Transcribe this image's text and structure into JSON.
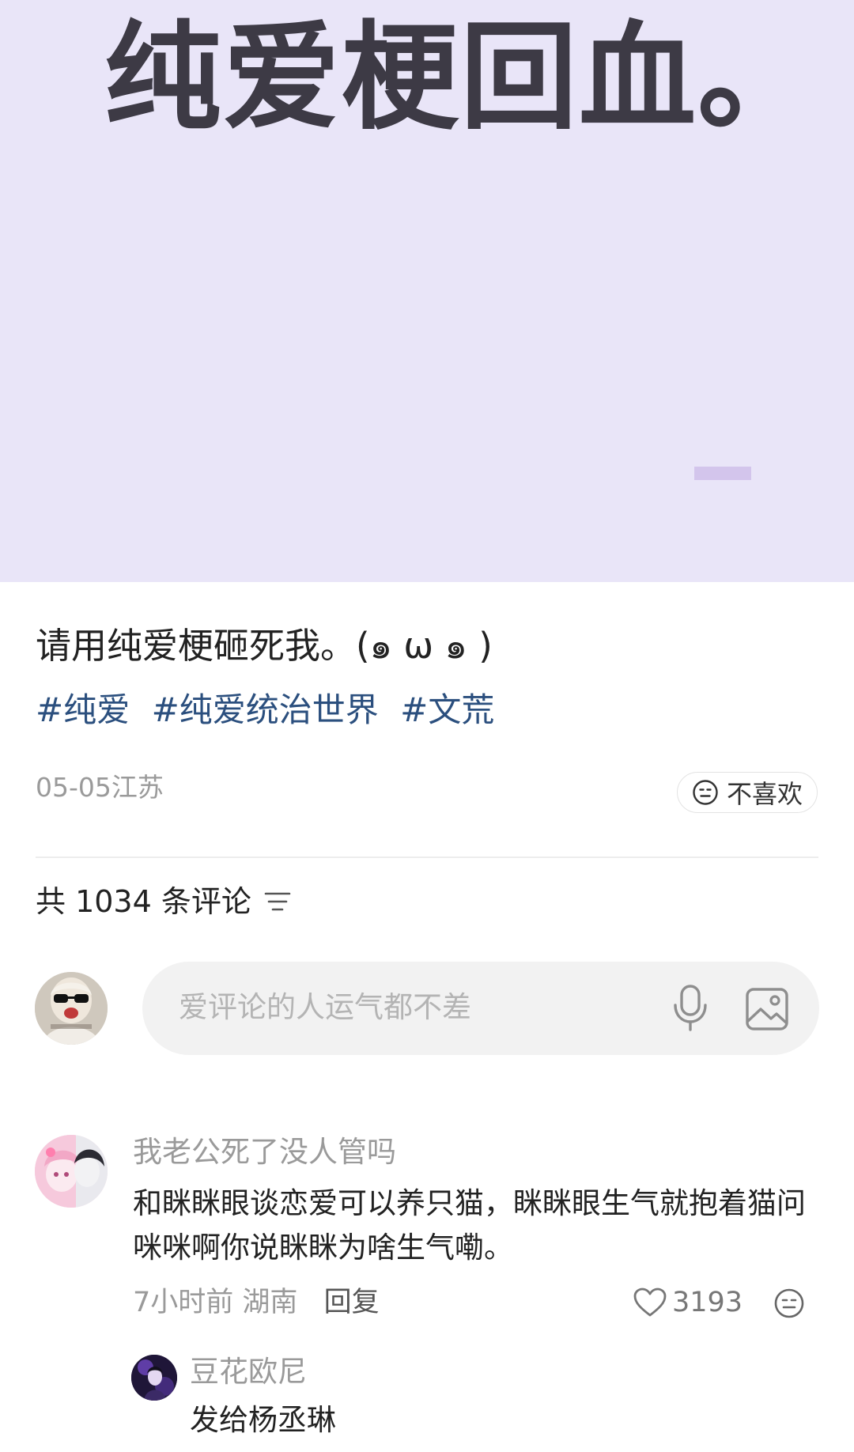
{
  "hero": {
    "title": "纯爱梗回血。"
  },
  "post": {
    "text": "请用纯爱梗砸死我。(๑ ω ๑ )",
    "tags": [
      "#纯爱",
      "#纯爱统治世界",
      "#文荒"
    ],
    "date_location": "05-05江苏",
    "dislike_label": "不喜欢",
    "dislike_icon": "neutral-face-icon"
  },
  "comments_section": {
    "count_label": "共 1034 条评论",
    "sort_icon": "sort-icon",
    "input_placeholder": "爱评论的人运气都不差",
    "mic_icon": "microphone-icon",
    "image_icon": "image-icon"
  },
  "comments": [
    {
      "user": "我老公死了没人管吗",
      "text": "和眯眯眼谈恋爱可以养只猫，眯眯眼生气就抱着猫问咪咪啊你说眯眯为啥生气嘞。",
      "time": "7小时前",
      "location": "湖南",
      "reply_label": "回复",
      "likes": "3193",
      "like_icon": "heart-icon",
      "react_icon": "neutral-face-icon",
      "replies": [
        {
          "user": "豆花欧尼",
          "text": "发给杨丞琳"
        }
      ]
    }
  ],
  "colors": {
    "hero_bg": "#e9e5f8",
    "hero_text": "#3d3a45",
    "tag": "#2b4f7e",
    "muted": "#9a9a9a",
    "input_bg": "#f2f2f2"
  }
}
